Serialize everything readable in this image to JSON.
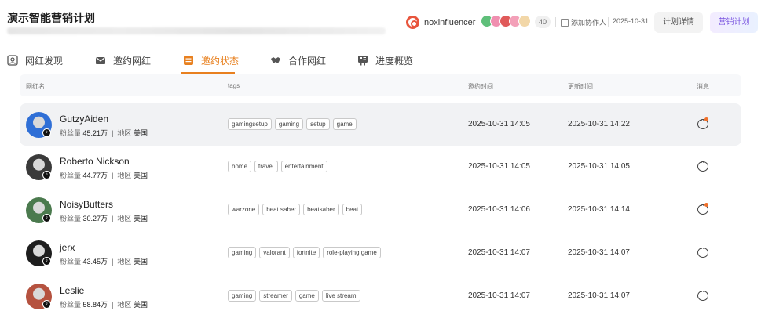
{
  "header": {
    "title": "演示智能营销计划",
    "brand_name": "noxinfluencer",
    "collaborator_count": "40",
    "add_collaborator": "添加协作人",
    "date": "2025-10-31",
    "plan_detail_label": "计划详情",
    "marketing_plan_label": "营销计划",
    "collaborator_colors": [
      "#5fbf7a",
      "#f08fb0",
      "#e05a5a",
      "#f3a0b8",
      "#f2d7a8"
    ]
  },
  "tabs": [
    {
      "label": "网红发现",
      "icon": "person-frame-icon"
    },
    {
      "label": "邀约网红",
      "icon": "mail-icon"
    },
    {
      "label": "邀约状态",
      "icon": "list-icon",
      "active": true
    },
    {
      "label": "合作网红",
      "icon": "handshake-icon"
    },
    {
      "label": "进度概览",
      "icon": "overview-icon"
    }
  ],
  "table": {
    "columns": [
      "网红名",
      "tags",
      "邀约时间",
      "更新时间",
      "消息"
    ],
    "fans_label": "粉丝量",
    "region_label": "地区",
    "rows": [
      {
        "name": "GutzyAiden",
        "fans": "45.21万",
        "region": "美国",
        "tags": [
          "gamingsetup",
          "gaming",
          "setup",
          "game"
        ],
        "invite_time": "2025-10-31 14:05",
        "update_time": "2025-10-31 14:22",
        "unread": true,
        "avatar_color": "#2f6fd6"
      },
      {
        "name": "Roberto Nickson",
        "fans": "44.77万",
        "region": "美国",
        "tags": [
          "home",
          "travel",
          "entertainment"
        ],
        "invite_time": "2025-10-31 14:05",
        "update_time": "2025-10-31 14:05",
        "unread": false,
        "avatar_color": "#3a3a3a"
      },
      {
        "name": "NoisyButters",
        "fans": "30.27万",
        "region": "美国",
        "tags": [
          "warzone",
          "beat saber",
          "beatsaber",
          "beat"
        ],
        "invite_time": "2025-10-31 14:06",
        "update_time": "2025-10-31 14:14",
        "unread": true,
        "avatar_color": "#4b7a4e"
      },
      {
        "name": "jerx",
        "fans": "43.45万",
        "region": "美国",
        "tags": [
          "gaming",
          "valorant",
          "fortnite",
          "role-playing game"
        ],
        "invite_time": "2025-10-31 14:07",
        "update_time": "2025-10-31 14:07",
        "unread": false,
        "avatar_color": "#1e1e1e"
      },
      {
        "name": "Leslie",
        "fans": "58.84万",
        "region": "美国",
        "tags": [
          "gaming",
          "streamer",
          "game",
          "live stream"
        ],
        "invite_time": "2025-10-31 14:07",
        "update_time": "2025-10-31 14:07",
        "unread": false,
        "avatar_color": "#b5523f"
      }
    ]
  }
}
